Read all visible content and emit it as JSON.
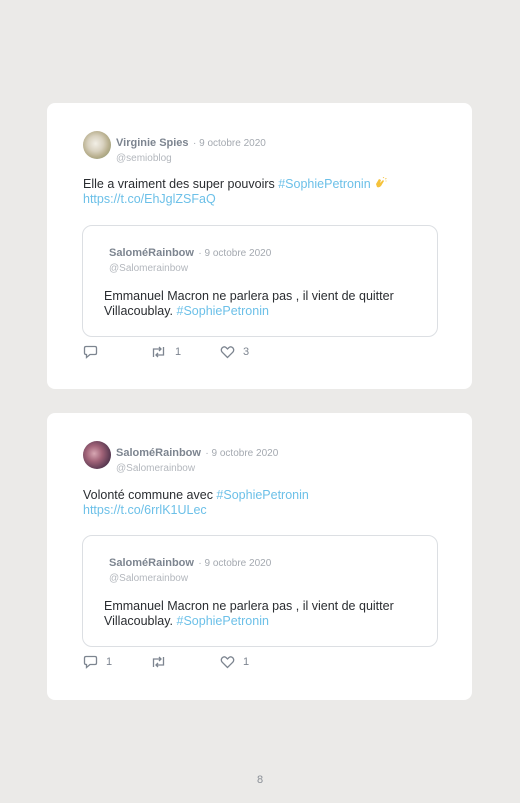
{
  "tweets": [
    {
      "author": "Virginie Spies",
      "date": "· 9 octobre 2020",
      "handle": "@semioblog",
      "text": "Elle a vraiment des super pouvoirs ",
      "hashtag": "#SophiePetronin",
      "link": "https://t.co/EhJglZSFaQ",
      "avatar_icon": "profile-photo",
      "emoji_icon": "clapping-hands-emoji",
      "quote": {
        "author": "SaloméRainbow",
        "date": "· 9 octobre 2020",
        "handle": "@Salomerainbow",
        "line1": "Emmanuel Macron ne parlera pas , il vient de quitter",
        "line2": "Villacoublay. ",
        "hashtag": "#SophiePetronin"
      },
      "actions": {
        "reply_count": "",
        "retweet_count": "1",
        "like_count": "3"
      }
    },
    {
      "author": "SaloméRainbow",
      "date": "· 9 octobre 2020",
      "handle": "@Salomerainbow",
      "text": "Volonté commune avec ",
      "hashtag": "#SophiePetronin",
      "link": "https://t.co/6rrlK1ULec",
      "avatar_icon": "profile-photo",
      "quote": {
        "author": "SaloméRainbow",
        "date": "· 9 octobre 2020",
        "handle": "@Salomerainbow",
        "line1": "Emmanuel Macron ne parlera pas , il vient de quitter",
        "line2": "Villacoublay. ",
        "hashtag": "#SophiePetronin"
      },
      "actions": {
        "reply_count": "1",
        "retweet_count": "",
        "like_count": "1"
      }
    }
  ],
  "colors": {
    "background": "#ebeae8",
    "card": "#ffffff",
    "hashtag": "#6cc0e8",
    "muted": "#7d8590"
  },
  "page_number": "8"
}
